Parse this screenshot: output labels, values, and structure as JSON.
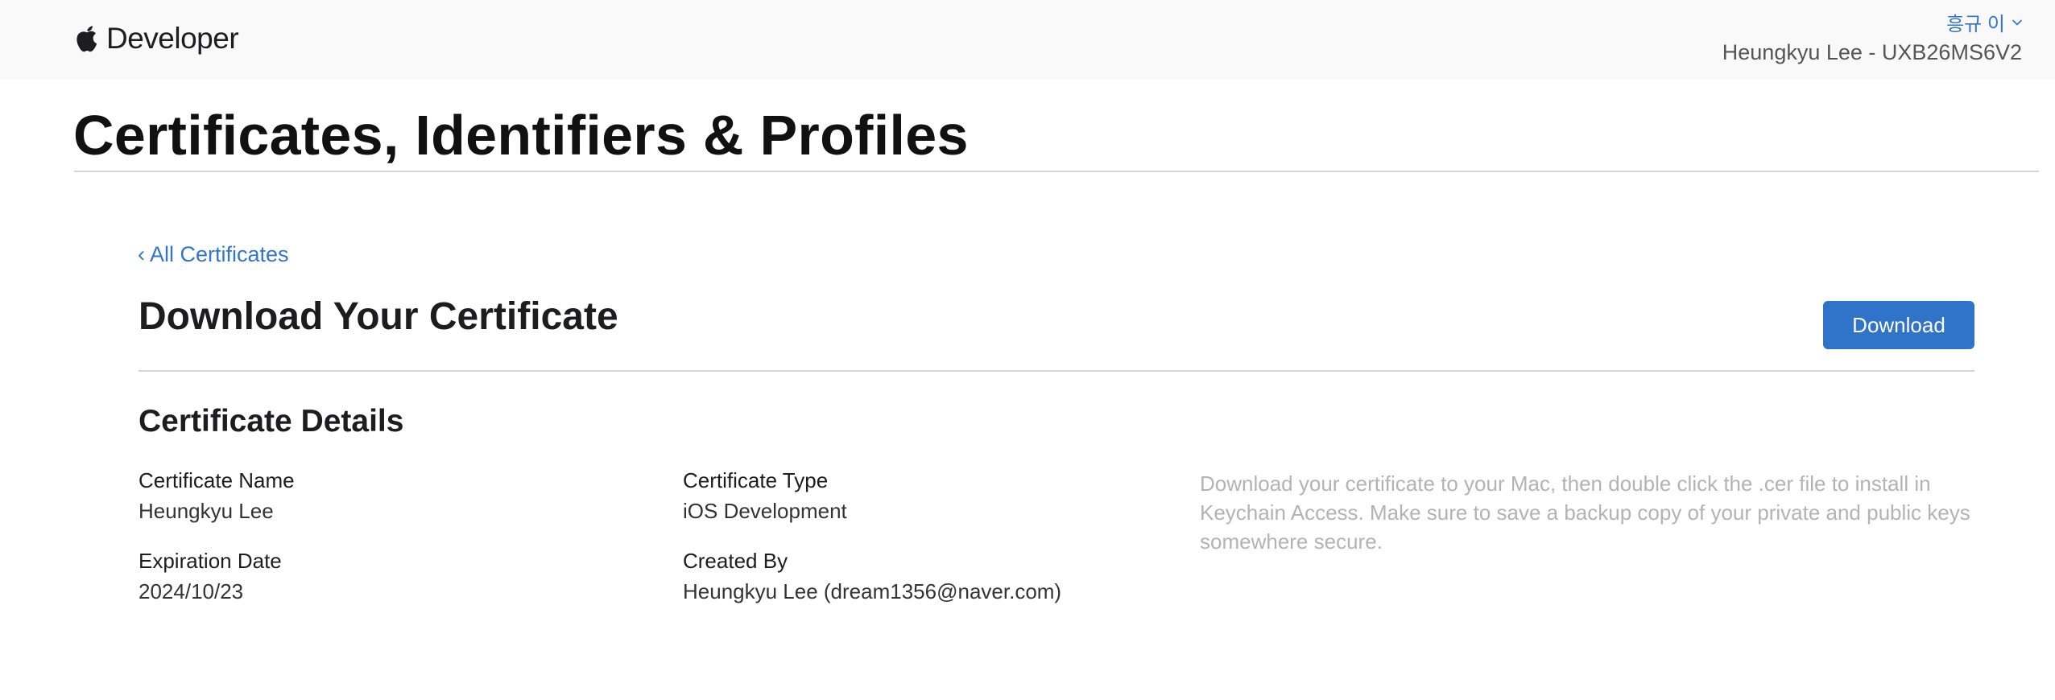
{
  "header": {
    "brand_label": "Developer",
    "user_menu_label": "흥규 이",
    "team_label": "Heungkyu Lee - UXB26MS6V2"
  },
  "page": {
    "title": "Certificates, Identifiers & Profiles"
  },
  "content": {
    "back_link_chevron": "‹",
    "back_link_label": "All Certificates",
    "heading": "Download Your Certificate",
    "download_button_label": "Download",
    "details_heading": "Certificate Details",
    "fields": {
      "certificate_name": {
        "label": "Certificate Name",
        "value": "Heungkyu Lee"
      },
      "certificate_type": {
        "label": "Certificate Type",
        "value": "iOS Development"
      },
      "expiration_date": {
        "label": "Expiration Date",
        "value": "2024/10/23"
      },
      "created_by": {
        "label": "Created By",
        "value": "Heungkyu Lee (dream1356@naver.com)"
      }
    },
    "help_text": "Download your certificate to your Mac, then double click the .cer file to install in Keychain Access. Make sure to save a backup copy of your private and public keys somewhere secure."
  },
  "icons": {
    "brand": "apple-logo-icon",
    "user_menu": "chevron-down-icon"
  },
  "colors": {
    "link": "#3375c8",
    "button": "#2f74c8",
    "header_background": "#f9f9f9",
    "help_text": "#b3b3b3"
  }
}
